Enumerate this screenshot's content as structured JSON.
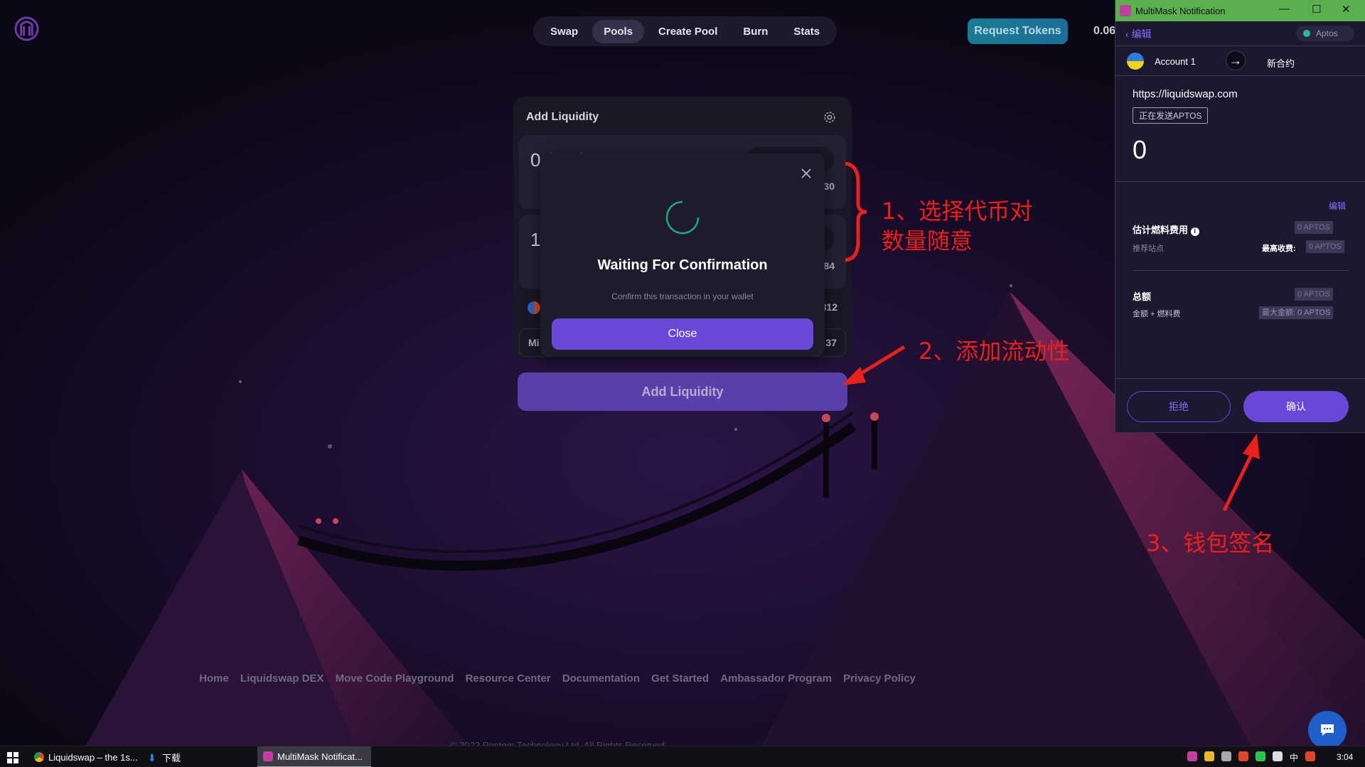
{
  "nav": {
    "items": [
      "Swap",
      "Pools",
      "Create Pool",
      "Burn",
      "Stats"
    ],
    "active_index": 1,
    "request_tokens": "Request Tokens",
    "balance": "0.06"
  },
  "card": {
    "title": "Add Liquidity",
    "input1_amount": "0.01504",
    "input1_side": "30",
    "input2_amount": "1",
    "input2_side": "84",
    "info_row1_right": "312",
    "info_row2_left": "Mi",
    "info_row2_right": "37",
    "submit_label": "Add Liquidity"
  },
  "modal": {
    "title": "Waiting For Confirmation",
    "subtitle": "Confirm this transaction in your wallet",
    "close_label": "Close"
  },
  "footer": {
    "links": [
      "Home",
      "Liquidswap DEX",
      "Move Code Playground",
      "Resource Center",
      "Documentation",
      "Get Started",
      "Ambassador Program",
      "Privacy Policy"
    ],
    "copyright": "© 2022 Pontem Technology Ltd. All Rights Reserved"
  },
  "annotations": {
    "step1_line1": "1、选择代币对",
    "step1_line2": "数量随意",
    "step2": "2、添加流动性",
    "step3": "3、钱包签名"
  },
  "wallet": {
    "window_title": "MultiMask Notification",
    "back_label": "编辑",
    "network": "Aptos",
    "account": "Account 1",
    "contract_label": "新合约",
    "url": "https://liquidswap.com",
    "sending_tag": "正在发送APTOS",
    "amount": "0",
    "edit_link": "编辑",
    "gas_label": "估计燃料费用",
    "gas_value": "0 APTOS",
    "recommended_label": "推荐站点",
    "max_fee_label": "最高收费:",
    "max_fee_value": "0 APTOS",
    "total_label": "总额",
    "total_value": "0 APTOS",
    "total_sub": "金额 + 燃料费",
    "max_amount_label": "最大金额:",
    "max_amount_value": "0 APTOS",
    "reject_label": "拒绝",
    "confirm_label": "确认"
  },
  "taskbar": {
    "tasks": [
      "Liquidswap – the 1s...",
      "下载",
      "MultiMask Notificat..."
    ],
    "ime": "中",
    "time": "3:04"
  },
  "colors": {
    "accent": "#6a47d6",
    "annotation_red": "#e9211c",
    "card_bg": "#1a1727"
  }
}
